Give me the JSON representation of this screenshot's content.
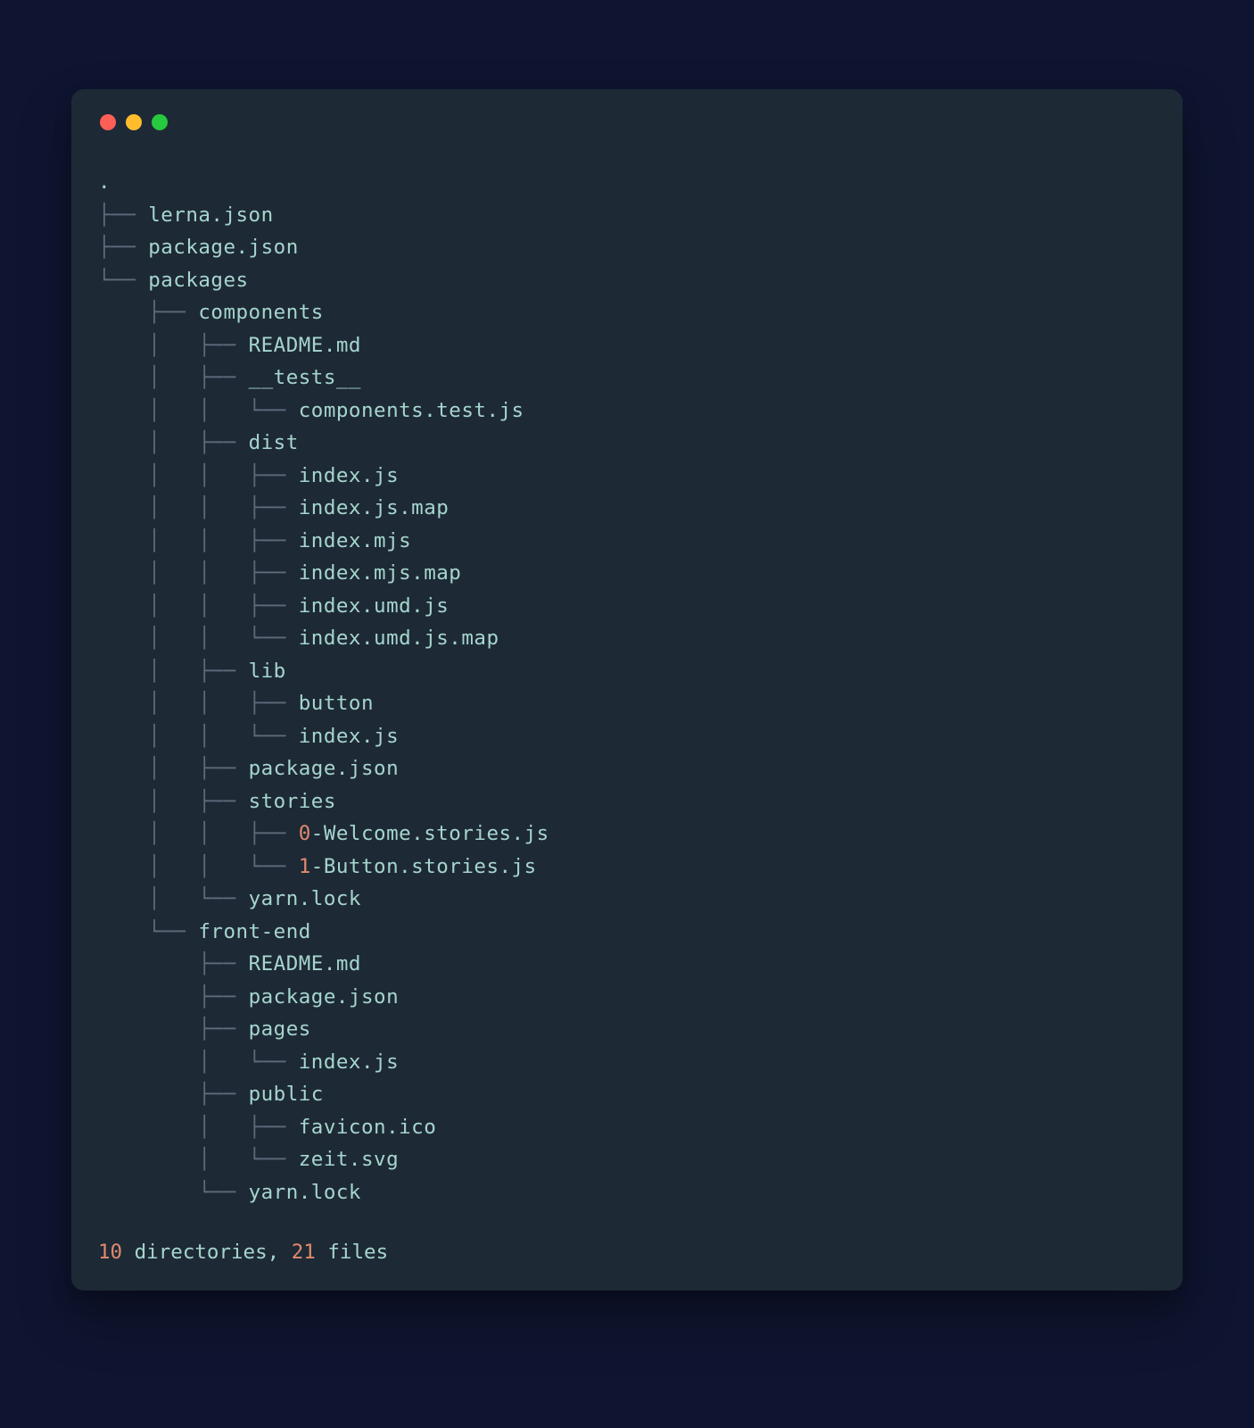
{
  "root": ".",
  "connectors": {
    "tee": "├── ",
    "elbow": "└── ",
    "pipe": "│   ",
    "space": "    "
  },
  "lines": [
    {
      "prefix": "",
      "text": "."
    },
    {
      "prefix": "├── ",
      "text": "lerna.json"
    },
    {
      "prefix": "├── ",
      "text": "package.json"
    },
    {
      "prefix": "└── ",
      "text": "packages"
    },
    {
      "prefix": "    ├── ",
      "text": "components"
    },
    {
      "prefix": "    │   ├── ",
      "text": "README.md"
    },
    {
      "prefix": "    │   ├── ",
      "text": "__tests__"
    },
    {
      "prefix": "    │   │   └── ",
      "text": "components.test.js"
    },
    {
      "prefix": "    │   ├── ",
      "text": "dist"
    },
    {
      "prefix": "    │   │   ├── ",
      "text": "index.js"
    },
    {
      "prefix": "    │   │   ├── ",
      "text": "index.js.map"
    },
    {
      "prefix": "    │   │   ├── ",
      "text": "index.mjs"
    },
    {
      "prefix": "    │   │   ├── ",
      "text": "index.mjs.map"
    },
    {
      "prefix": "    │   │   ├── ",
      "text": "index.umd.js"
    },
    {
      "prefix": "    │   │   └── ",
      "text": "index.umd.js.map"
    },
    {
      "prefix": "    │   ├── ",
      "text": "lib"
    },
    {
      "prefix": "    │   │   ├── ",
      "text": "button"
    },
    {
      "prefix": "    │   │   └── ",
      "text": "index.js"
    },
    {
      "prefix": "    │   ├── ",
      "text": "package.json"
    },
    {
      "prefix": "    │   ├── ",
      "text": "stories"
    },
    {
      "prefix": "    │   │   ├── ",
      "hl": "0",
      "text": "-Welcome.stories.js"
    },
    {
      "prefix": "    │   │   └── ",
      "hl": "1",
      "text": "-Button.stories.js"
    },
    {
      "prefix": "    │   └── ",
      "text": "yarn.lock"
    },
    {
      "prefix": "    └── ",
      "text": "front-end"
    },
    {
      "prefix": "        ├── ",
      "text": "README.md"
    },
    {
      "prefix": "        ├── ",
      "text": "package.json"
    },
    {
      "prefix": "        ├── ",
      "text": "pages"
    },
    {
      "prefix": "        │   └── ",
      "text": "index.js"
    },
    {
      "prefix": "        ├── ",
      "text": "public"
    },
    {
      "prefix": "        │   ├── ",
      "text": "favicon.ico"
    },
    {
      "prefix": "        │   └── ",
      "text": "zeit.svg"
    },
    {
      "prefix": "        └── ",
      "text": "yarn.lock"
    }
  ],
  "summary": {
    "dir_count": "10",
    "dir_label": " directories, ",
    "file_count": "21",
    "file_label": " files"
  }
}
